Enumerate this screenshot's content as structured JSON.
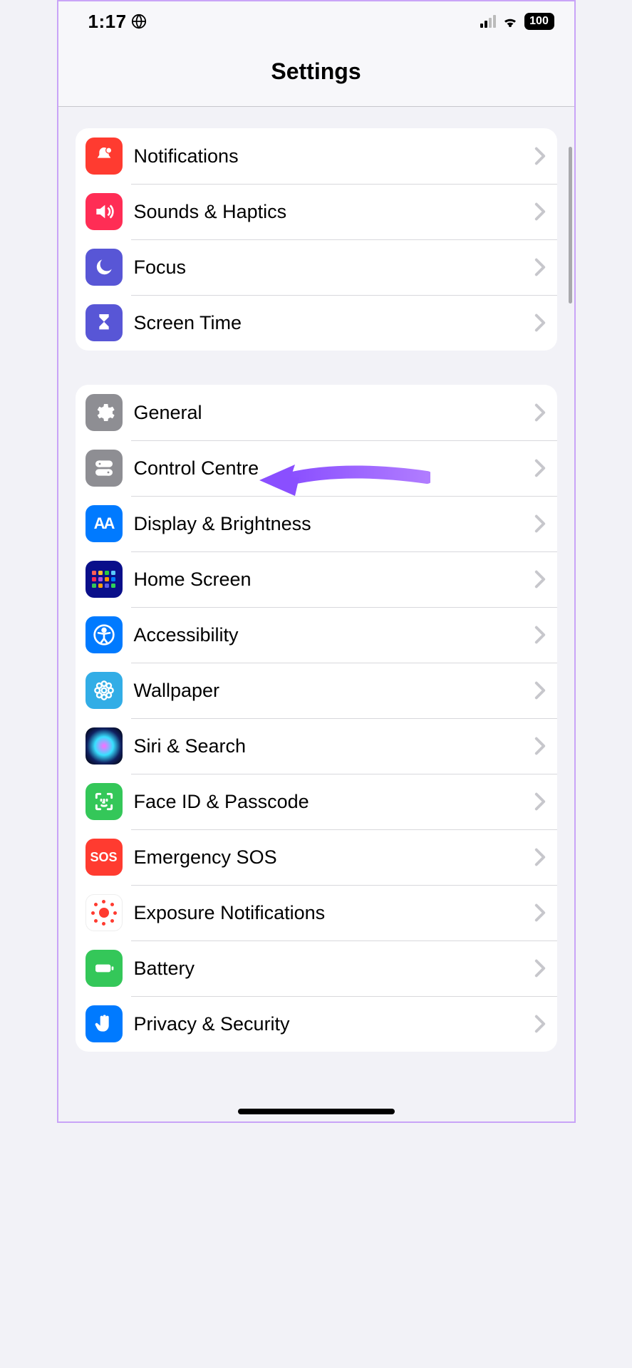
{
  "status": {
    "time": "1:17",
    "battery": "100"
  },
  "header": {
    "title": "Settings"
  },
  "group1": [
    {
      "label": "Notifications"
    },
    {
      "label": "Sounds & Haptics"
    },
    {
      "label": "Focus"
    },
    {
      "label": "Screen Time"
    }
  ],
  "group2": [
    {
      "label": "General"
    },
    {
      "label": "Control Centre"
    },
    {
      "label": "Display & Brightness"
    },
    {
      "label": "Home Screen"
    },
    {
      "label": "Accessibility"
    },
    {
      "label": "Wallpaper"
    },
    {
      "label": "Siri & Search"
    },
    {
      "label": "Face ID & Passcode"
    },
    {
      "label": "Emergency SOS"
    },
    {
      "label": "Exposure Notifications"
    },
    {
      "label": "Battery"
    },
    {
      "label": "Privacy & Security"
    }
  ],
  "sos_text": "SOS"
}
